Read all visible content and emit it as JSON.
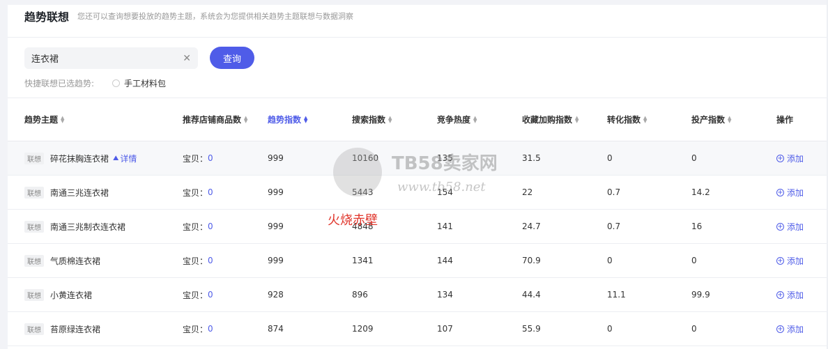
{
  "header": {
    "title": "趋势联想",
    "subtitle": "您还可以查询想要投放的趋势主题，系统会为您提供相关趋势主题联想与数据洞察"
  },
  "search": {
    "value": "连衣裙",
    "clear_icon": "close-icon",
    "button_label": "查询"
  },
  "quick": {
    "label": "快捷联想已选趋势:",
    "option_label": "手工材料包",
    "option_checked": false
  },
  "colors": {
    "accent": "#4f5ce8",
    "text": "#333333",
    "muted": "#999999",
    "watermark_red": "#e0362c"
  },
  "table": {
    "columns": [
      {
        "label": "趋势主题",
        "sortable": true,
        "active": false
      },
      {
        "label": "推荐店铺商品数",
        "sortable": true,
        "active": false
      },
      {
        "label": "趋势指数",
        "sortable": true,
        "active": true
      },
      {
        "label": "搜索指数",
        "sortable": true,
        "active": false
      },
      {
        "label": "竞争热度",
        "sortable": true,
        "active": false
      },
      {
        "label": "收藏加购指数",
        "sortable": true,
        "active": false
      },
      {
        "label": "转化指数",
        "sortable": true,
        "active": false
      },
      {
        "label": "投产指数",
        "sortable": true,
        "active": false
      },
      {
        "label": "操作",
        "sortable": false,
        "active": false
      }
    ],
    "tag_label": "联想",
    "shop_prefix": "宝贝：",
    "detail_label": "详情",
    "add_label": "添加",
    "rows": [
      {
        "topic": "碎花抹胸连衣裙",
        "shop_count": "0",
        "trend": "999",
        "search": "10160",
        "competition": "135",
        "fav": "31.5",
        "conversion": "0",
        "roi": "0",
        "highlighted": true,
        "has_detail": true
      },
      {
        "topic": "南通三兆连衣裙",
        "shop_count": "0",
        "trend": "999",
        "search": "5443",
        "competition": "154",
        "fav": "22",
        "conversion": "0.7",
        "roi": "14.2",
        "highlighted": false,
        "has_detail": false
      },
      {
        "topic": "南通三兆制衣连衣裙",
        "shop_count": "0",
        "trend": "999",
        "search": "4848",
        "competition": "141",
        "fav": "24.7",
        "conversion": "0.7",
        "roi": "16",
        "highlighted": false,
        "has_detail": false
      },
      {
        "topic": "气质棉连衣裙",
        "shop_count": "0",
        "trend": "999",
        "search": "1341",
        "competition": "144",
        "fav": "70.9",
        "conversion": "0",
        "roi": "0",
        "highlighted": false,
        "has_detail": false
      },
      {
        "topic": "小黄连衣裙",
        "shop_count": "0",
        "trend": "928",
        "search": "896",
        "competition": "134",
        "fav": "44.4",
        "conversion": "11.1",
        "roi": "99.9",
        "highlighted": false,
        "has_detail": false
      },
      {
        "topic": "苔原绿连衣裙",
        "shop_count": "0",
        "trend": "874",
        "search": "1209",
        "competition": "107",
        "fav": "55.9",
        "conversion": "0",
        "roi": "0",
        "highlighted": false,
        "has_detail": false
      }
    ]
  },
  "watermark": {
    "brand": "TB58卖家网",
    "url": "www.tb58.net",
    "stamp": "火烧赤壁"
  }
}
